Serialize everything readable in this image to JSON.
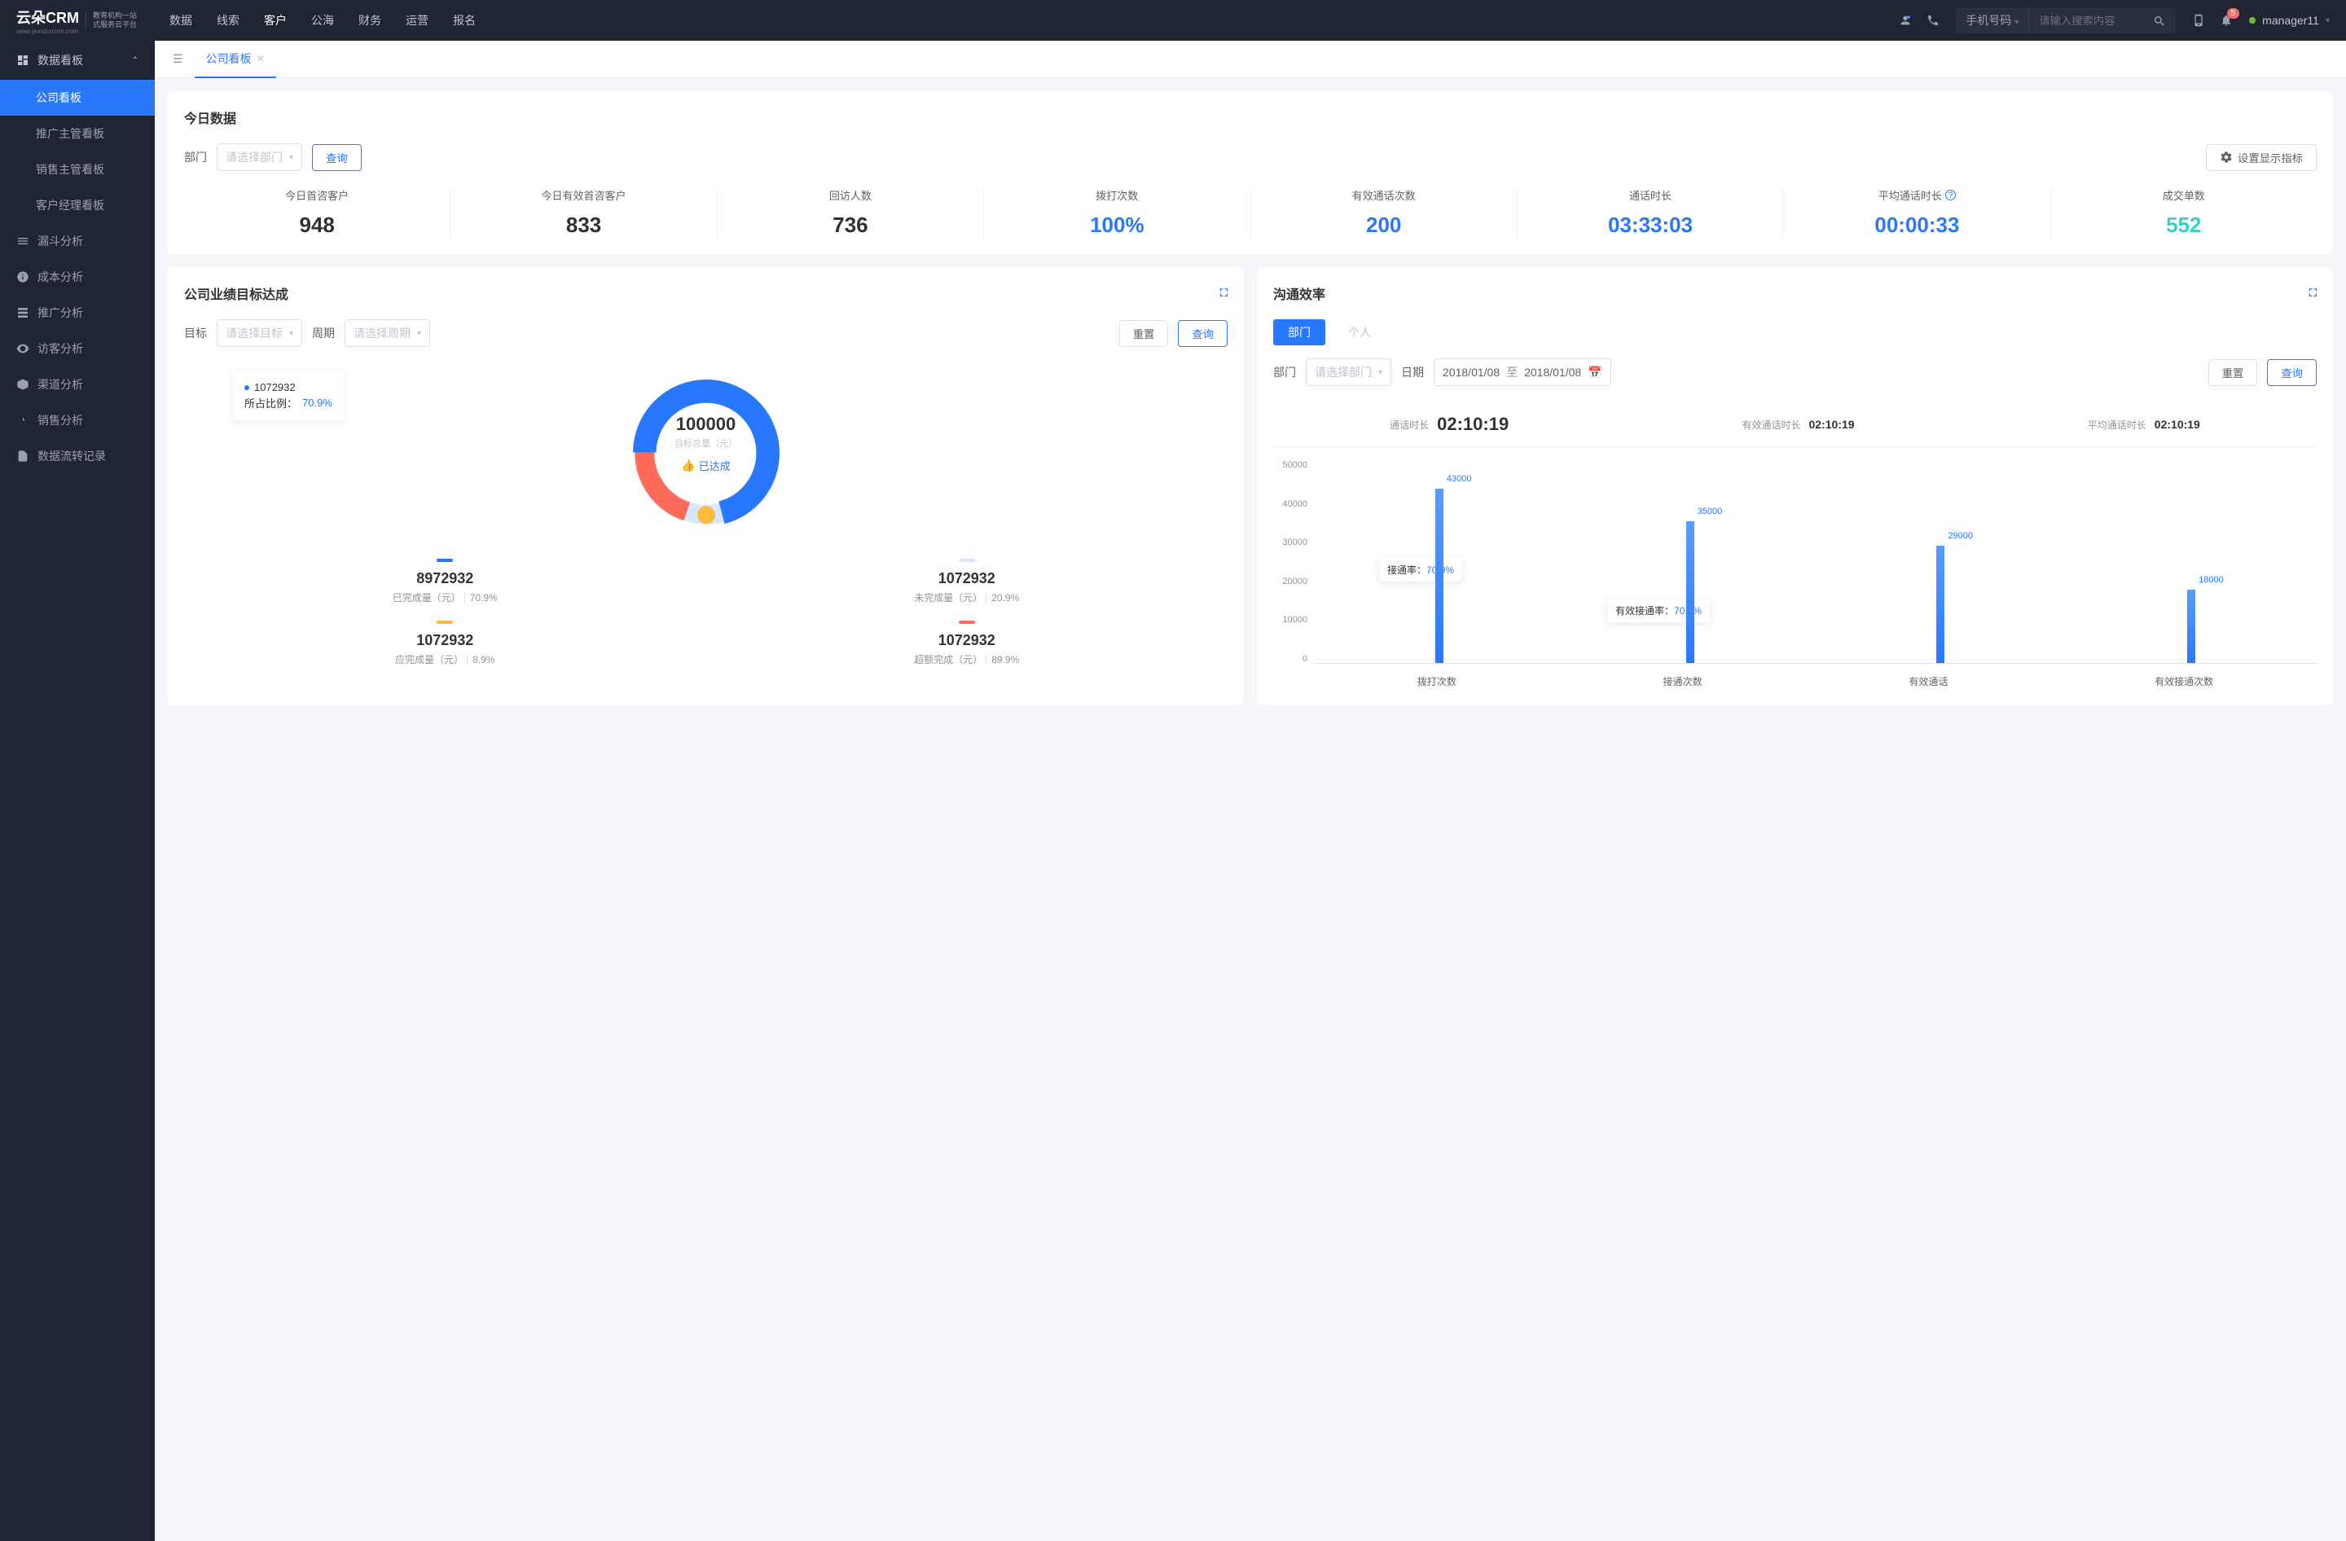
{
  "header": {
    "logo_main": "云朵CRM",
    "logo_url": "www.yunduocrm.com",
    "logo_sub1": "教育机构一站",
    "logo_sub2": "式服务云平台",
    "nav": [
      "数据",
      "线索",
      "客户",
      "公海",
      "财务",
      "运营",
      "报名"
    ],
    "nav_active_index": 2,
    "search_type": "手机号码",
    "search_placeholder": "请输入搜索内容",
    "badge_count": "5",
    "user_name": "manager11"
  },
  "sidebar": {
    "group": {
      "label": "数据看板"
    },
    "subitems": [
      "公司看板",
      "推广主管看板",
      "销售主管看板",
      "客户经理看板"
    ],
    "sub_active_index": 0,
    "items": [
      "漏斗分析",
      "成本分析",
      "推广分析",
      "访客分析",
      "渠道分析",
      "销售分析",
      "数据流转记录"
    ]
  },
  "tabs": {
    "active_label": "公司看板"
  },
  "today": {
    "title": "今日数据",
    "dept_label": "部门",
    "dept_placeholder": "请选择部门",
    "query_btn": "查询",
    "settings_btn": "设置显示指标",
    "kpis": [
      {
        "label": "今日首咨客户",
        "value": "948",
        "color": "#303133"
      },
      {
        "label": "今日有效首咨客户",
        "value": "833",
        "color": "#303133"
      },
      {
        "label": "回访人数",
        "value": "736",
        "color": "#303133"
      },
      {
        "label": "拨打次数",
        "value": "100%",
        "color": "#2878ff"
      },
      {
        "label": "有效通话次数",
        "value": "200",
        "color": "#2878ff"
      },
      {
        "label": "通话时长",
        "value": "03:33:03",
        "color": "#2878ff"
      },
      {
        "label": "平均通话时长",
        "value": "00:00:33",
        "color": "#2878ff",
        "info": true
      },
      {
        "label": "成交单数",
        "value": "552",
        "color": "#36cfc9"
      }
    ]
  },
  "goal": {
    "title": "公司业绩目标达成",
    "target_label": "目标",
    "target_placeholder": "请选择目标",
    "period_label": "周期",
    "period_placeholder": "请选择周期",
    "reset_btn": "重置",
    "query_btn": "查询",
    "center_value": "100000",
    "center_sub": "目标总量（元）",
    "achieved_text": "已达成",
    "tooltip_value": "1072932",
    "tooltip_ratio_label": "所占比例：",
    "tooltip_ratio": "70.9%",
    "legend": [
      {
        "color": "#2878ff",
        "value": "8972932",
        "label": "已完成量（元）",
        "pct": "70.9%"
      },
      {
        "color": "#d6e8ff",
        "value": "1072932",
        "label": "未完成量（元）",
        "pct": "20.9%"
      },
      {
        "color": "#ffba3b",
        "value": "1072932",
        "label": "应完成量（元）",
        "pct": "8.9%"
      },
      {
        "color": "#ff6b5b",
        "value": "1072932",
        "label": "超额完成（元）",
        "pct": "89.9%"
      }
    ]
  },
  "comm": {
    "title": "沟通效率",
    "pill_dept": "部门",
    "pill_personal": "个人",
    "dept_label": "部门",
    "dept_placeholder": "请选择部门",
    "date_label": "日期",
    "date_from": "2018/01/08",
    "date_to": "2018/01/08",
    "date_sep": "至",
    "reset_btn": "重置",
    "query_btn": "查询",
    "summary": [
      {
        "label": "通话时长",
        "value": "02:10:19",
        "big": true
      },
      {
        "label": "有效通话时长",
        "value": "02:10:19"
      },
      {
        "label": "平均通话时长",
        "value": "02:10:19"
      }
    ],
    "tooltips": [
      {
        "label": "接通率：",
        "value": "70.9%"
      },
      {
        "label": "有效接通率：",
        "value": "70.9%"
      }
    ]
  },
  "chart_data": [
    {
      "type": "donut",
      "title": "公司业绩目标达成",
      "series": [
        {
          "name": "已完成量（元）",
          "value": 8972932,
          "pct": 70.9,
          "color": "#2878ff"
        },
        {
          "name": "未完成量（元）",
          "value": 1072932,
          "pct": 20.9,
          "color": "#d6e8ff"
        },
        {
          "name": "应完成量（元）",
          "value": 1072932,
          "pct": 8.9,
          "color": "#ffba3b"
        },
        {
          "name": "超额完成（元）",
          "value": 1072932,
          "pct": 89.9,
          "color": "#ff6b5b"
        }
      ],
      "center_value": 100000,
      "center_label": "目标总量（元）"
    },
    {
      "type": "bar",
      "title": "沟通效率",
      "categories": [
        "拨打次数",
        "接通次数",
        "有效通话",
        "有效接通次数"
      ],
      "values": [
        43000,
        35000,
        29000,
        18000
      ],
      "ylim": [
        0,
        50000
      ],
      "yticks": [
        0,
        10000,
        20000,
        30000,
        40000,
        50000
      ],
      "ylabel": "",
      "xlabel": ""
    }
  ]
}
